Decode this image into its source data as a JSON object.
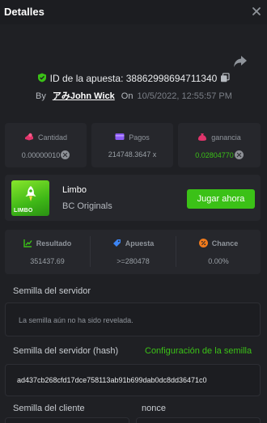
{
  "header": {
    "title": "Detalles"
  },
  "bet": {
    "id_label": "ID de la apuesta:",
    "id_value": "38862998694711340",
    "by_label": "By",
    "user": "アみJohn Wick",
    "on_label": "On",
    "date": "10/5/2022, 12:55:57 PM"
  },
  "stats": {
    "amount": {
      "label": "Cantidad",
      "value": "0.00000010"
    },
    "payout": {
      "label": "Pagos",
      "value": "214748.3647 x"
    },
    "profit": {
      "label": "ganancia",
      "value": "0.02804770"
    }
  },
  "game": {
    "thumb_brand": "LIMBO",
    "name": "Limbo",
    "provider": "BC Originals",
    "play_label": "Jugar ahora"
  },
  "results": {
    "result": {
      "label": "Resultado",
      "value": "351437.69"
    },
    "bet": {
      "label": "Apuesta",
      "value": ">=280478"
    },
    "chance": {
      "label": "Chance",
      "value": "0.00%"
    }
  },
  "seeds": {
    "server_seed_label": "Semilla del servidor",
    "server_seed_placeholder": "La semilla aún no ha sido revelada.",
    "server_hash_label": "Semilla del servidor (hash)",
    "seed_settings_link": "Configuración de la semilla",
    "server_hash_value": "ad437cb268cfd17dce758113ab91b699dab0dc8dd36471c0",
    "client_seed_label": "Semilla del cliente",
    "nonce_label": "nonce"
  },
  "colors": {
    "background": "#1f2024",
    "panel": "#26272c",
    "accent_green": "#3bc117",
    "amount_icon": "#e0346b",
    "payout_icon": "#8d5cf6",
    "profit_icon": "#e0346b",
    "result_icon": "#3bc117",
    "bet_icon": "#3d86f5",
    "chance_icon": "#f07a1c"
  },
  "icons": {
    "close": "close-icon",
    "share": "share-icon",
    "verified": "shield-check-icon",
    "copy": "copy-icon",
    "amount": "coins-icon",
    "payout": "wallet-icon",
    "profit": "money-bag-icon",
    "result": "chart-icon",
    "bet": "tag-icon",
    "chance": "percent-icon",
    "currency": "currency-coin-icon"
  }
}
